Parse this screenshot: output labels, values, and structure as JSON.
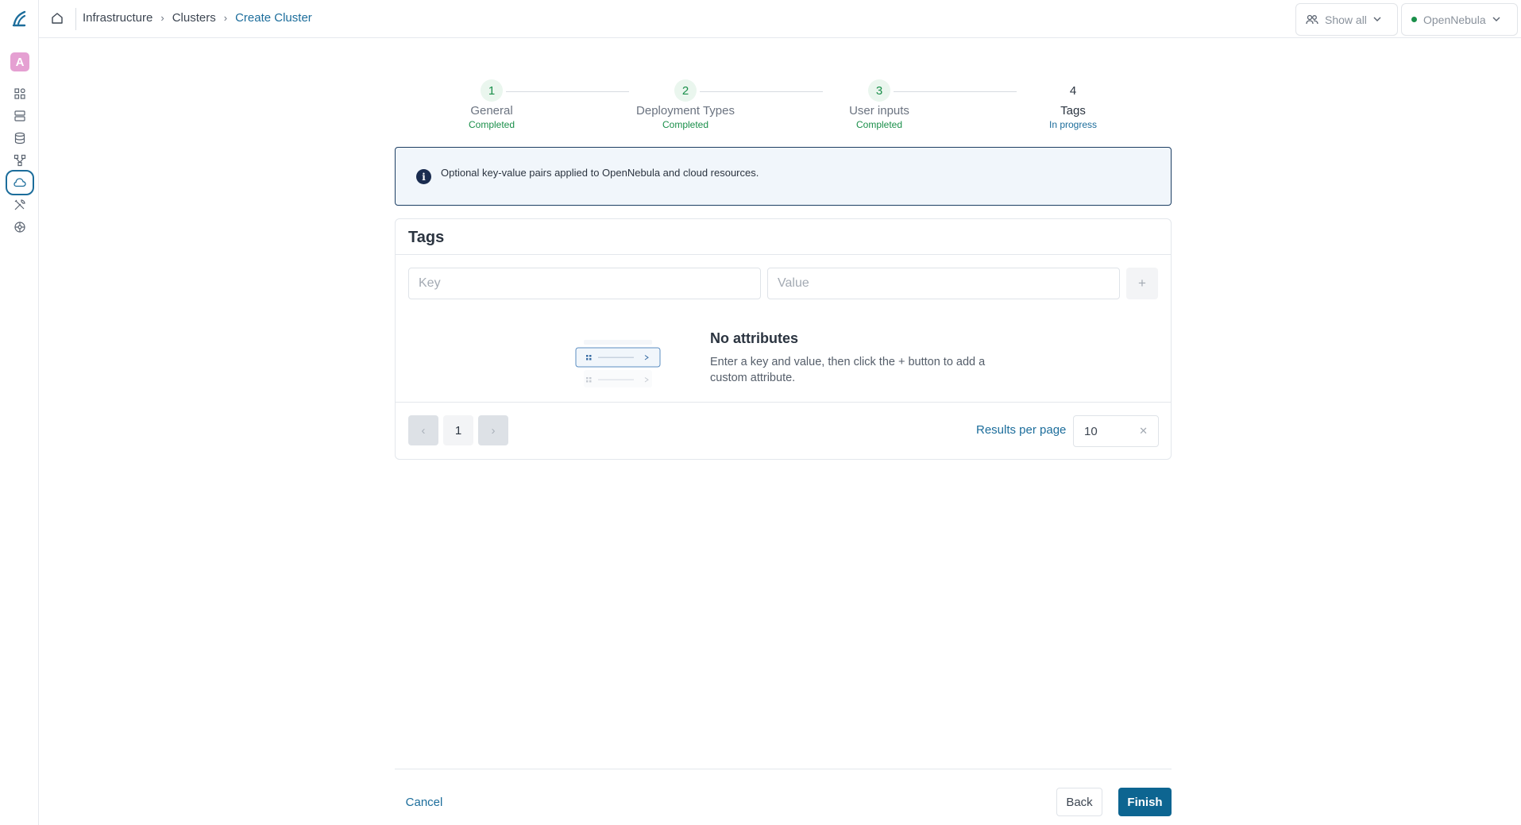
{
  "sidebar": {
    "avatar_letter": "A",
    "items": [
      {
        "icon": "dashboard-icon"
      },
      {
        "icon": "instances-icon"
      },
      {
        "icon": "storage-icon"
      },
      {
        "icon": "network-icon"
      },
      {
        "icon": "cloud-icon",
        "active": true
      },
      {
        "icon": "tools-icon"
      },
      {
        "icon": "settings-icon"
      }
    ]
  },
  "header": {
    "breadcrumb": [
      "Infrastructure",
      "Clusters",
      "Create Cluster"
    ],
    "show_all": "Show all",
    "zone": "OpenNebula"
  },
  "stepper": [
    {
      "num": "1",
      "title": "General",
      "status": "Completed"
    },
    {
      "num": "2",
      "title": "Deployment Types",
      "status": "Completed"
    },
    {
      "num": "3",
      "title": "User inputs",
      "status": "Completed"
    },
    {
      "num": "4",
      "title": "Tags",
      "status": "In progress"
    }
  ],
  "info": {
    "text": "Optional key-value pairs applied to OpenNebula and cloud resources."
  },
  "tags": {
    "title": "Tags",
    "key_placeholder": "Key",
    "value_placeholder": "Value",
    "add_label": "+",
    "empty_title": "No attributes",
    "empty_desc": "Enter a key and value, then click the + button to add a custom attribute.",
    "pager": {
      "prev": "‹",
      "page": "1",
      "next": "›"
    },
    "results_per_page_label": "Results per page",
    "results_per_page": "10"
  },
  "footer": {
    "cancel": "Cancel",
    "back": "Back",
    "finish": "Finish"
  },
  "colors": {
    "primary": "#0d6591",
    "completed": "#1a8f4a",
    "link": "#1c6d9b"
  }
}
